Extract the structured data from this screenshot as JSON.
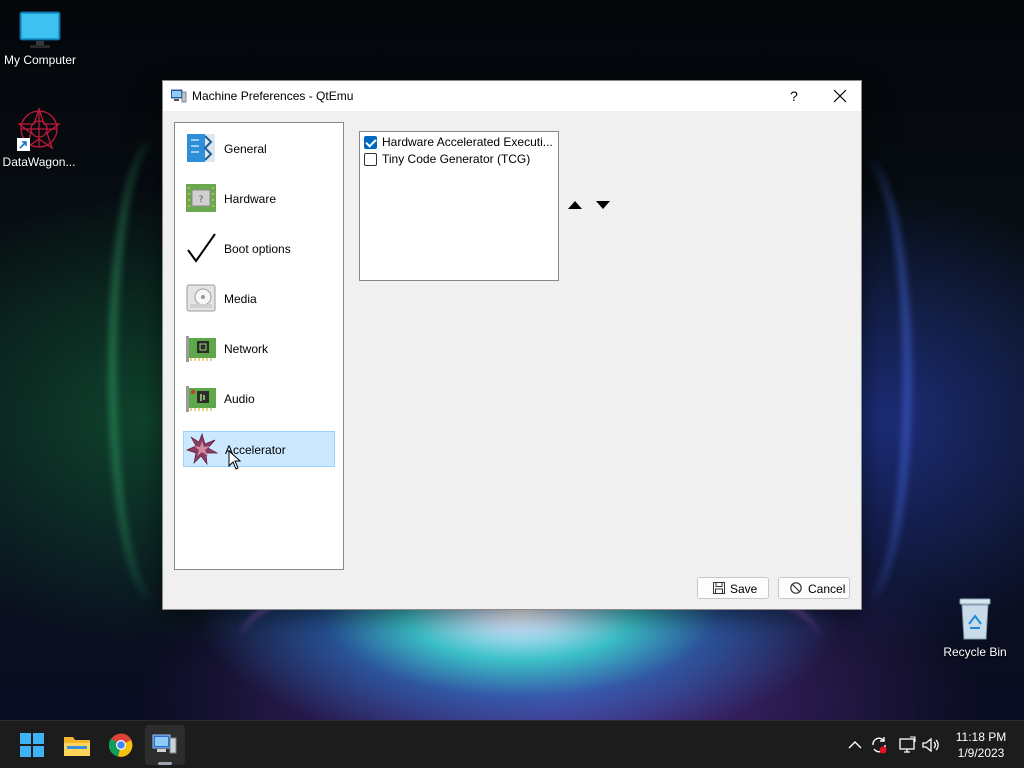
{
  "desktop": {
    "icons": [
      {
        "label": "My Computer",
        "icon": "monitor-icon"
      },
      {
        "label": "DataWagon...",
        "icon": "datawagon-icon"
      },
      {
        "label": "Recycle Bin",
        "icon": "recycle-bin-icon"
      }
    ]
  },
  "dialog": {
    "title": "Machine Preferences - QtEmu",
    "help_label": "?",
    "close_label": "✕",
    "sidebar": {
      "selected": "Accelerator",
      "items": [
        {
          "label": "General",
          "icon": "general-icon"
        },
        {
          "label": "Hardware",
          "icon": "hardware-icon"
        },
        {
          "label": "Boot options",
          "icon": "checkmark-icon"
        },
        {
          "label": "Media",
          "icon": "media-icon"
        },
        {
          "label": "Network",
          "icon": "network-card-icon"
        },
        {
          "label": "Audio",
          "icon": "audio-card-icon"
        },
        {
          "label": "Accelerator",
          "icon": "accelerator-star-icon"
        }
      ]
    },
    "accelerators": [
      {
        "label": "Hardware Accelerated Executi...",
        "checked": true
      },
      {
        "label": "Tiny Code Generator (TCG)",
        "checked": false
      }
    ],
    "buttons": {
      "save_label": "Save",
      "cancel_label": "Cancel"
    }
  },
  "taskbar": {
    "apps": [
      "start-icon",
      "file-explorer-icon",
      "chrome-icon",
      "qtemu-icon"
    ],
    "active_app": "qtemu-icon",
    "clock": {
      "time": "11:18 PM",
      "date": "1/9/2023"
    }
  },
  "colors": {
    "selection_bg": "#cce8ff",
    "checkbox_accent": "#0067c0",
    "taskbar_bg": "#1c1c1c"
  }
}
